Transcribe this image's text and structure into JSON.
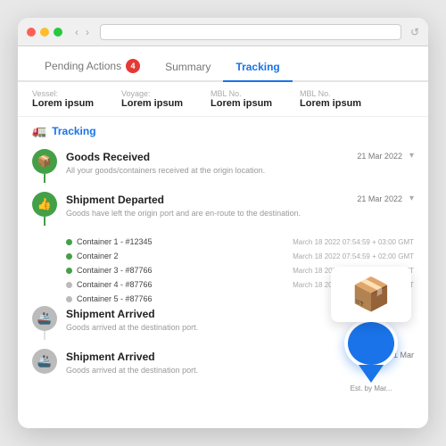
{
  "window": {
    "title": "Tracking"
  },
  "titlebar": {
    "back": "‹",
    "forward": "›"
  },
  "tabs": [
    {
      "id": "pending",
      "label": "Pending Actions",
      "badge": "4",
      "active": false
    },
    {
      "id": "summary",
      "label": "Summary",
      "active": false
    },
    {
      "id": "tracking",
      "label": "Tracking",
      "active": true
    }
  ],
  "info_fields": [
    {
      "label": "Vessel:",
      "value": "Lorem ipsum"
    },
    {
      "label": "Voyage:",
      "value": "Lorem ipsum"
    },
    {
      "label": "MBL No.",
      "value": "Lorem ipsum"
    },
    {
      "label": "MBL No.",
      "value": "Lorem ipsum"
    }
  ],
  "section_header": "Tracking",
  "timeline": [
    {
      "id": "goods-received",
      "icon": "📦",
      "icon_type": "package",
      "status": "green",
      "title": "Goods Received",
      "description": "All your goods/containers received at the origin location.",
      "date": "21 Mar 2022",
      "has_chevron": true
    },
    {
      "id": "shipment-departed",
      "icon": "👍",
      "icon_type": "thumb",
      "status": "green",
      "title": "Shipment Departed",
      "description": "Goods have left the origin port and are en-route to the destination.",
      "date": "21 Mar 2022",
      "has_chevron": true,
      "containers": [
        {
          "label": "Container 1 - #12345",
          "date": "March 18 2022 07:54:59 + 03:00 GMT",
          "dot": "green"
        },
        {
          "label": "Container 2",
          "date": "March 18 2022 07:54:59 + 02:00 GMT",
          "dot": "green"
        },
        {
          "label": "Container 3 - #87766",
          "date": "March 18 2022 07:54:59 + 02:00 GMT",
          "dot": "green"
        },
        {
          "label": "Container 4 - #87766",
          "date": "March 18 2022 07:54:59 + 03:00 GMT",
          "dot": "grey"
        },
        {
          "label": "Container 5 - #87766",
          "date": "",
          "dot": "grey"
        }
      ]
    },
    {
      "id": "shipment-arrived-1",
      "icon": "🚢",
      "icon_type": "ship",
      "status": "grey",
      "title": "Shipment Arrived",
      "description": "Goods arrived at the destination port.",
      "date": "",
      "has_chevron": false
    },
    {
      "id": "shipment-arrived-2",
      "icon": "🚢",
      "icon_type": "ship",
      "status": "grey",
      "title": "Shipment Arrived",
      "description": "Goods arrived at the destination port.",
      "date": "21 Mar",
      "has_chevron": false
    }
  ],
  "pin": {
    "small_text": "Est. by Mar..."
  },
  "colors": {
    "green": "#43a047",
    "blue": "#1a73e8",
    "grey": "#bbb"
  }
}
